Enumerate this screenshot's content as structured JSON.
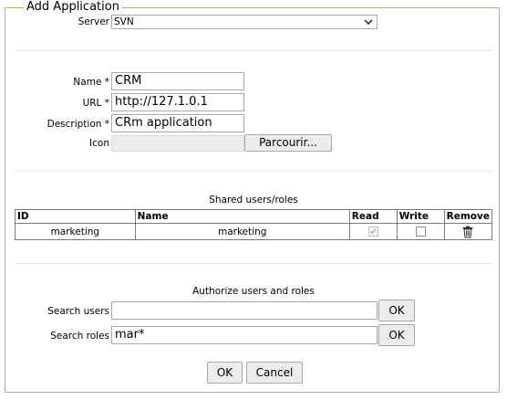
{
  "legend": "Add Application",
  "server": {
    "label": "Server",
    "value": "SVN"
  },
  "fields": {
    "name": {
      "label": "Name *",
      "value": "CRM"
    },
    "url": {
      "label": "URL *",
      "value": "http://127.1.0.1"
    },
    "description": {
      "label": "Description *",
      "value": "CRm application"
    },
    "icon": {
      "label": "Icon",
      "button": "Parcourir..."
    }
  },
  "shared": {
    "caption": "Shared users/roles",
    "headers": {
      "id": "ID",
      "name": "Name",
      "read": "Read",
      "write": "Write",
      "remove": "Remove"
    },
    "rows": [
      {
        "id": "marketing",
        "name": "marketing",
        "read": true,
        "write": false
      }
    ]
  },
  "authorize": {
    "caption": "Authorize users and roles",
    "search_users": {
      "label": "Search users",
      "value": "",
      "button": "OK"
    },
    "search_roles": {
      "label": "Search roles",
      "value": "mar*",
      "button": "OK"
    }
  },
  "actions": {
    "ok": "OK",
    "cancel": "Cancel"
  },
  "colors": {
    "frame": "#c9a978",
    "button_bg": "#ececec"
  }
}
